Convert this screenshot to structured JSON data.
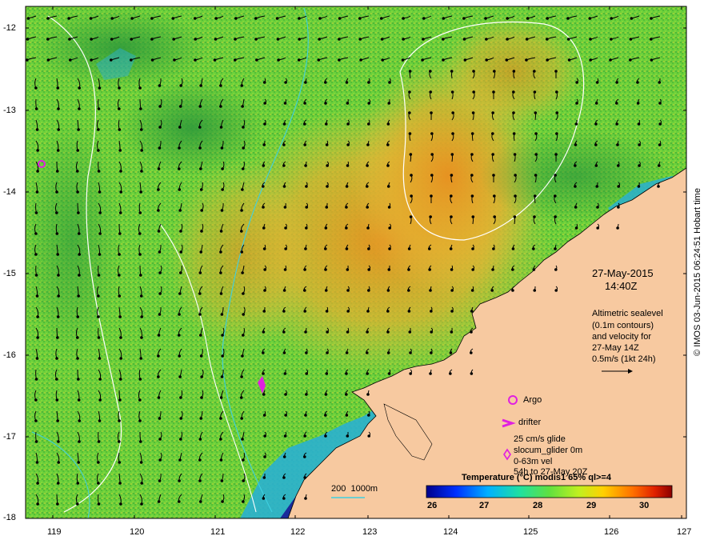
{
  "map": {
    "y_ticks": [
      "-12",
      "-13",
      "-14",
      "-15",
      "-16",
      "-17",
      "-18"
    ],
    "x_ticks": [
      "119",
      "120",
      "121",
      "122",
      "123",
      "124",
      "125",
      "126",
      "127"
    ],
    "colors": {
      "land": "#f7c9a0",
      "ocean_base": "#5cc83a",
      "warm": "#e0a22a",
      "cool": "#2aa8d8",
      "deep_cool": "#1a2a9a",
      "contour_white": "#ffffff",
      "contour_cyan": "#3fd0e0",
      "marker": "#e020e0"
    }
  },
  "annotations": {
    "date": "27-May-2015",
    "time": "14:40Z",
    "altimetric_lines": [
      "Altimetric sealevel",
      "(0.1m contours)",
      "and velocity for",
      "27-May 14Z",
      "0.5m/s (1kt 24h)"
    ],
    "argo_label": "Argo",
    "drifter_label": "drifter",
    "glider_lines": [
      "25 cm/s glide",
      "slocum_glider 0m",
      "0-63m vel",
      "54h to 27-May 20Z"
    ],
    "depth_legend": "200  1000m",
    "credit": "© IMOS 03-Jun-2015 06:24:51 Hobart time"
  },
  "colorbar": {
    "title": "Temperature (°C) modis1 65% ql>=4",
    "ticks": [
      "26",
      "27",
      "28",
      "29",
      "30"
    ],
    "stops": [
      "#00008b",
      "#0030ff",
      "#00b0ff",
      "#20e0a0",
      "#60e040",
      "#c0f020",
      "#ffd000",
      "#ff7000",
      "#e02000",
      "#8b0000"
    ]
  }
}
